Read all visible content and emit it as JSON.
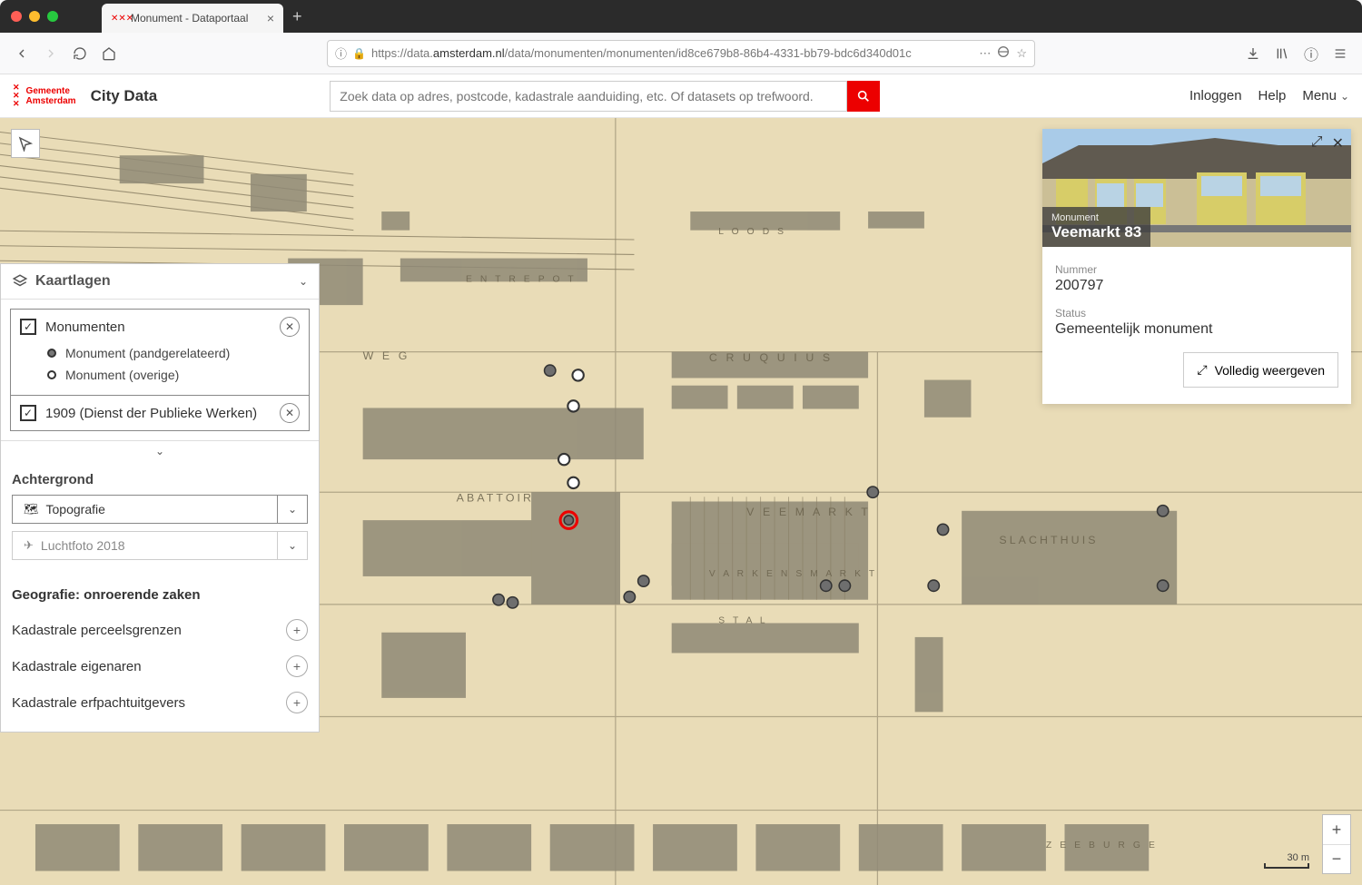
{
  "browser": {
    "tab_title": "Monument - Dataportaal",
    "url_prefix": "https://data.",
    "url_domain": "amsterdam.nl",
    "url_path": "/data/monumenten/monumenten/id8ce679b8-86b4-4331-bb79-bdc6d340d01c"
  },
  "header": {
    "org_line1": "Gemeente",
    "org_line2": "Amsterdam",
    "app_title": "City Data",
    "search_placeholder": "Zoek data op adres, postcode, kadastrale aanduiding, etc. Of datasets op trefwoord.",
    "nav": {
      "login": "Inloggen",
      "help": "Help",
      "menu": "Menu"
    }
  },
  "layers_panel": {
    "title": "Kaartlagen",
    "layer1": {
      "label": "Monumenten"
    },
    "legend": {
      "related": "Monument (pandgerelateerd)",
      "other": "Monument (overige)"
    },
    "layer2": {
      "label": "1909 (Dienst der Publieke Werken)"
    },
    "background": {
      "section": "Achtergrond",
      "topografie": "Topografie",
      "luchtfoto": "Luchtfoto 2018"
    },
    "geo": {
      "section": "Geografie: onroerende zaken",
      "row1": "Kadastrale perceelsgrenzen",
      "row2": "Kadastrale eigenaren",
      "row3": "Kadastrale erfpachtuitgevers"
    }
  },
  "detail": {
    "type_label": "Monument",
    "title": "Veemarkt 83",
    "nummer_label": "Nummer",
    "nummer_value": "200797",
    "status_label": "Status",
    "status_value": "Gemeentelijk monument",
    "full_btn": "Volledig weergeven"
  },
  "scale": {
    "label": "30 m"
  }
}
